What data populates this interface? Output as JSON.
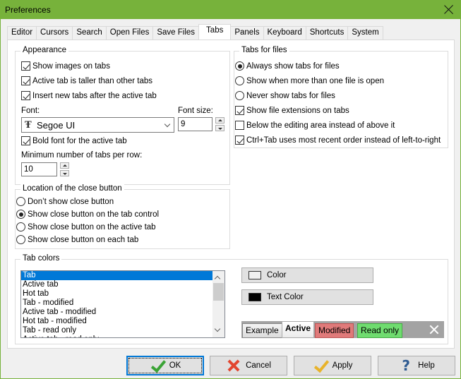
{
  "window": {
    "title": "Preferences"
  },
  "tabs": [
    {
      "label": "Editor",
      "active": false
    },
    {
      "label": "Cursors",
      "active": false
    },
    {
      "label": "Search",
      "active": false
    },
    {
      "label": "Open Files",
      "active": false
    },
    {
      "label": "Save Files",
      "active": false
    },
    {
      "label": "Tabs",
      "active": true
    },
    {
      "label": "Panels",
      "active": false
    },
    {
      "label": "Keyboard",
      "active": false
    },
    {
      "label": "Shortcuts",
      "active": false
    },
    {
      "label": "System",
      "active": false
    }
  ],
  "appearance": {
    "title": "Appearance",
    "show_images": {
      "label": "Show images on tabs",
      "checked": true
    },
    "active_taller": {
      "label": "Active tab is taller than other tabs",
      "checked": true
    },
    "insert_after": {
      "label": "Insert new tabs after the active tab",
      "checked": true
    },
    "font_label": "Font:",
    "font_value": "Segoe UI",
    "font_icon": "truetype-font-icon",
    "font_size_label": "Font size:",
    "font_size_value": "9",
    "bold_active": {
      "label": "Bold font for the active tab",
      "checked": true
    },
    "min_tabs_label": "Minimum number of tabs per row:",
    "min_tabs_value": "10"
  },
  "tabs_for_files": {
    "title": "Tabs for files",
    "radio_always": {
      "label": "Always show tabs for files",
      "checked": true
    },
    "radio_more_than_one": {
      "label": "Show when more than one file is open",
      "checked": false
    },
    "radio_never": {
      "label": "Never show tabs for files",
      "checked": false
    },
    "show_extensions": {
      "label": "Show file extensions on tabs",
      "checked": true
    },
    "below_editing": {
      "label": "Below the editing area instead of above it",
      "checked": false
    },
    "ctrl_tab": {
      "label": "Ctrl+Tab uses most recent order instead of left-to-right",
      "checked": true
    }
  },
  "close_button": {
    "title": "Location of the close button",
    "options": [
      {
        "label": "Don’t show close button",
        "checked": false
      },
      {
        "label": "Show close button on the tab control",
        "checked": true
      },
      {
        "label": "Show close button on the active tab",
        "checked": false
      },
      {
        "label": "Show close button on each tab",
        "checked": false
      }
    ]
  },
  "tab_colors": {
    "title": "Tab colors",
    "items": [
      "Tab",
      "Active tab",
      "Hot tab",
      "Tab - modified",
      "Active tab - modified",
      "Hot tab - modified",
      "Tab - read only",
      "Active tab - read only"
    ],
    "selected_index": 0,
    "color_button": {
      "label": "Color",
      "swatch": "#f0f0f0"
    },
    "text_color_button": {
      "label": "Text Color",
      "swatch": "#000000"
    },
    "preview": {
      "example": "Example",
      "active": "Active",
      "modified": "Modified",
      "read_only": "Read only",
      "modified_color": "#e07a7a",
      "read_only_color": "#6fdc6f"
    }
  },
  "buttons": {
    "ok": "OK",
    "cancel": "Cancel",
    "apply": "Apply",
    "help": "Help"
  },
  "colors": {
    "titlebar": "#77b23b",
    "selection": "#0078d7"
  }
}
